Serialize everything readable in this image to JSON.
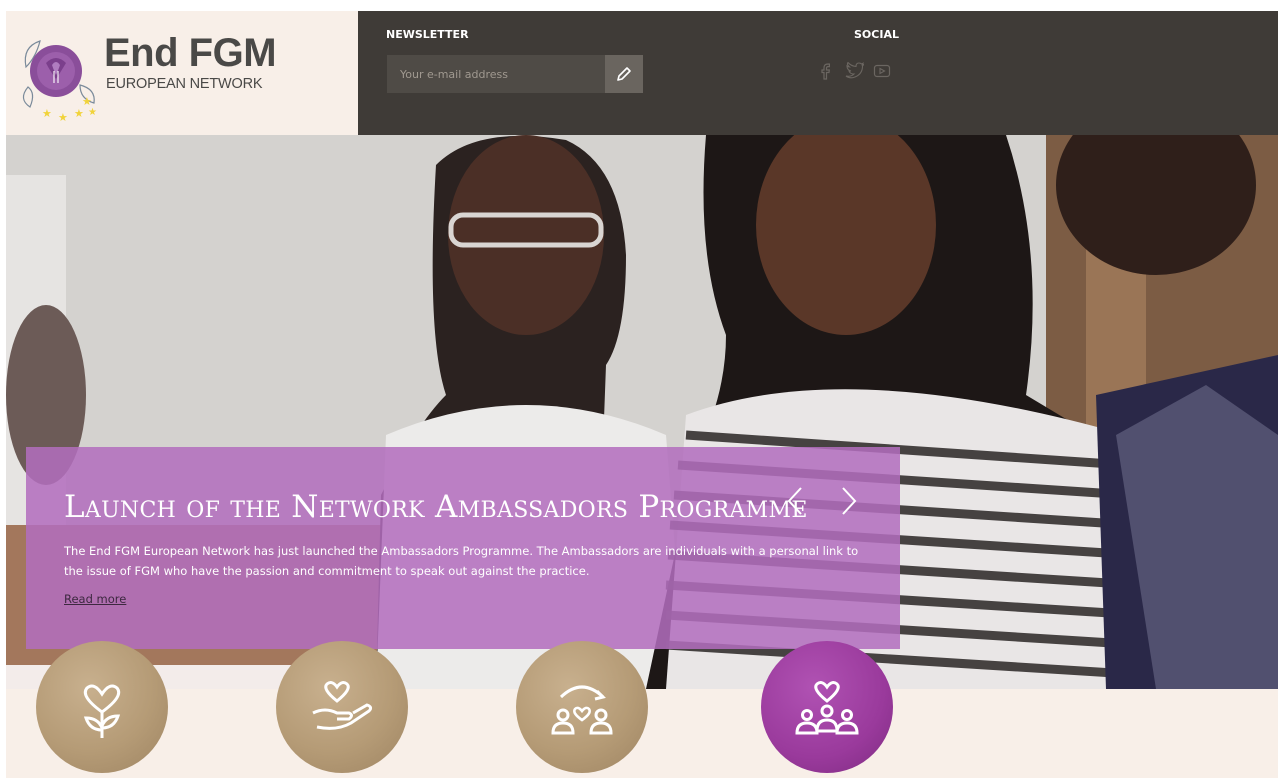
{
  "header": {
    "logo": {
      "title": "End FGM",
      "subtitle": "EUROPEAN NETWORK"
    },
    "newsletter": {
      "label": "NEWSLETTER",
      "placeholder": "Your e-mail address",
      "submit_icon": "pencil-icon"
    },
    "social": {
      "label": "SOCIAL",
      "icons": [
        "facebook-icon",
        "twitter-icon",
        "youtube-icon"
      ]
    }
  },
  "hero": {
    "title": "Launch of the Network Ambassadors Programme",
    "description": "The End FGM European Network has just launched the Ambassadors Programme. The Ambassadors are individuals with a personal link to the issue of FGM who have the passion and commitment to speak out against the practice.",
    "read_more": "Read more",
    "prev_icon": "chevron-left-icon",
    "next_icon": "chevron-right-icon"
  },
  "features": [
    {
      "icon": "heart-flower-icon",
      "color": "#b59b76"
    },
    {
      "icon": "heart-hand-icon",
      "color": "#b59b76"
    },
    {
      "icon": "people-exchange-icon",
      "color": "#b59b76"
    },
    {
      "icon": "community-heart-icon",
      "color": "#9a3a9c"
    }
  ],
  "colors": {
    "header_dark": "#3f3b37",
    "accent_purple": "#b26ebe",
    "gold": "#b59b76",
    "background": "#f8efe8"
  }
}
